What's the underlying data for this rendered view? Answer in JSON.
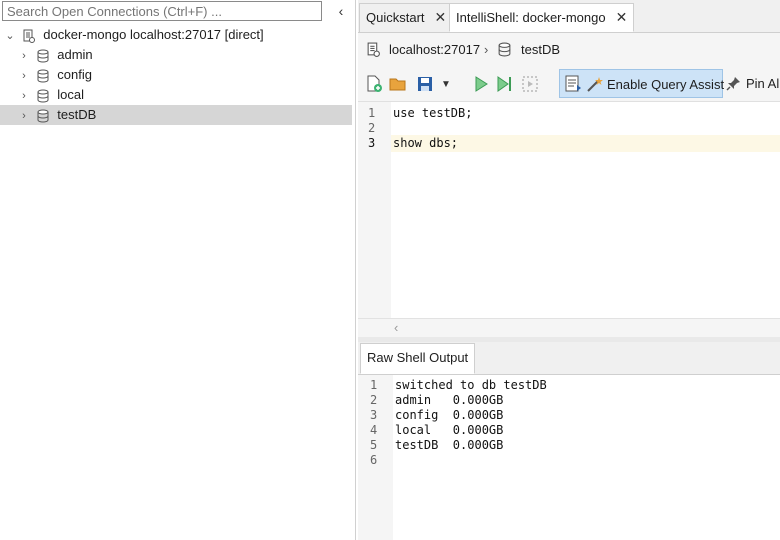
{
  "sidebar": {
    "search_placeholder": "Search Open Connections (Ctrl+F) ...",
    "collapse_glyph": "‹",
    "connection_label": "docker-mongo localhost:27017 [direct]",
    "databases": [
      {
        "label": "admin"
      },
      {
        "label": "config"
      },
      {
        "label": "local"
      },
      {
        "label": "testDB"
      }
    ],
    "selected_database": "testDB"
  },
  "tabs": [
    {
      "label": "Quickstart",
      "close": "✕"
    },
    {
      "label": "IntelliShell: docker-mongo",
      "close": "✕"
    }
  ],
  "breadcrumb": {
    "host": "localhost:27017",
    "database": "testDB"
  },
  "toolbar": {
    "assist_label": "Enable Query Assist",
    "pin_label": "Pin All"
  },
  "editor": {
    "line_numbers": [
      "1",
      "2",
      "3"
    ],
    "lines": [
      "use testDB;",
      "",
      "show dbs;"
    ],
    "current_line": "3"
  },
  "output": {
    "tab_label": "Raw Shell Output",
    "line_numbers": [
      "1",
      "2",
      "3",
      "4",
      "5",
      "6"
    ],
    "lines": [
      "switched to db testDB",
      "admin   0.000GB",
      "config  0.000GB",
      "local   0.000GB",
      "testDB  0.000GB",
      ""
    ]
  },
  "colors": {
    "selection": "#d6d6d6",
    "assist_bg": "#cde3f7",
    "run_green": "#3cb371",
    "folder_orange": "#e8a33d",
    "save_blue": "#2a5fa6",
    "current_line": "#fdf8e5"
  }
}
